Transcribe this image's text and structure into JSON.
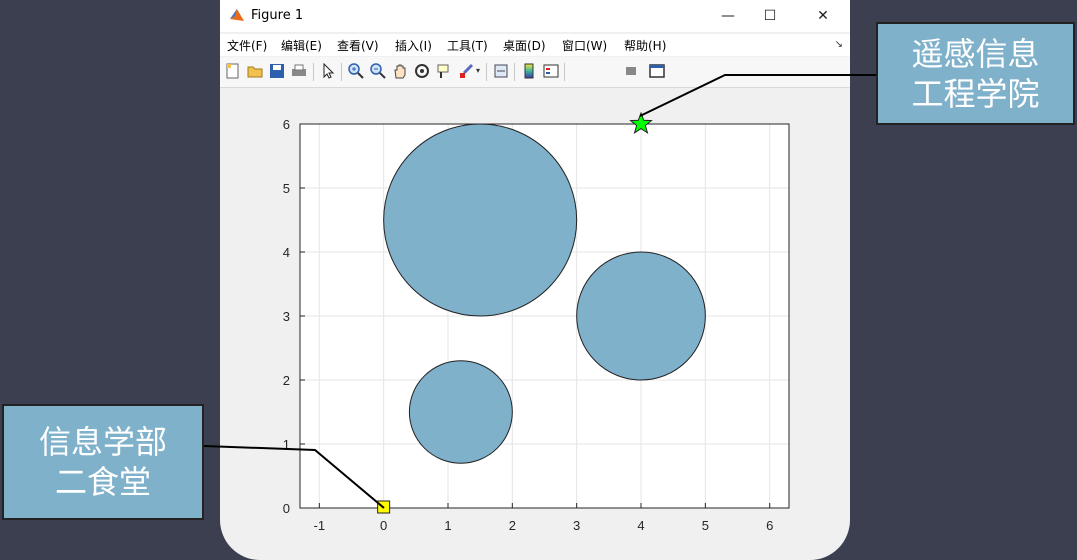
{
  "window": {
    "title": "Figure 1",
    "minimize_glyph": "—",
    "maximize_glyph": "☐",
    "close_glyph": "✕",
    "icon": "matlab-icon"
  },
  "menu": {
    "items": [
      "文件(F)",
      "编辑(E)",
      "查看(V)",
      "插入(I)",
      "工具(T)",
      "桌面(D)",
      "窗口(W)",
      "帮助(H)"
    ],
    "arrow_glyph": "↘"
  },
  "toolbar": {
    "icons": [
      "new-figure-icon",
      "open-icon",
      "save-icon",
      "print-icon",
      "pointer-icon",
      "zoom-in-icon",
      "zoom-out-icon",
      "pan-icon",
      "rotate-icon",
      "data-cursor-icon",
      "brush-icon",
      "link-icon",
      "colorbar-icon",
      "legend-icon",
      "hide-tools-icon",
      "dock-icon"
    ]
  },
  "callouts": {
    "top": {
      "line1": "遥感信息",
      "line2": "工程学院"
    },
    "left": {
      "line1": "信息学部",
      "line2": "二食堂"
    }
  },
  "chart_data": {
    "type": "scatter",
    "title": "",
    "xlabel": "",
    "ylabel": "",
    "xlim": [
      -1.3,
      6.3
    ],
    "ylim": [
      0,
      6
    ],
    "xticks": [
      -1,
      0,
      1,
      2,
      3,
      4,
      5,
      6
    ],
    "yticks": [
      0,
      1,
      2,
      3,
      4,
      5,
      6
    ],
    "grid": true,
    "circles": [
      {
        "cx": 1.5,
        "cy": 4.5,
        "r": 1.5
      },
      {
        "cx": 4.0,
        "cy": 3.0,
        "r": 1.0
      },
      {
        "cx": 1.2,
        "cy": 1.5,
        "r": 0.8
      }
    ],
    "markers": [
      {
        "x": 4,
        "y": 6,
        "shape": "pentagram",
        "color": "#00ff00"
      },
      {
        "x": 0,
        "y": 0,
        "shape": "square",
        "color": "#ffff00"
      }
    ],
    "circle_fill": "#7fb1cb",
    "circle_stroke": "#222222"
  }
}
